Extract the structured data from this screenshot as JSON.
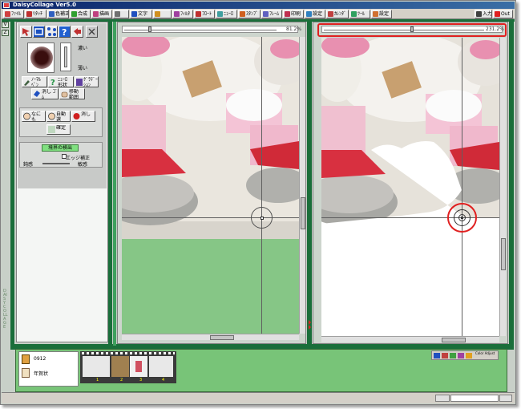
{
  "window": {
    "title": "DaisyCollage Ver5.0"
  },
  "menu": [
    {
      "label": "ﾌｧｲﾙ",
      "color": "#d04040"
    },
    {
      "label": "ﾘﾀｯﾁ",
      "color": "#c03030"
    },
    {
      "label": "色補正",
      "color": "#3060c0"
    },
    {
      "label": "合成",
      "color": "#30a030"
    },
    {
      "label": "描画",
      "color": "#c04080"
    },
    {
      "label": "",
      "color": "#707070"
    },
    {
      "label": "文字",
      "color": "#2050c0"
    },
    {
      "label": "",
      "color": "#d09020"
    },
    {
      "label": "ﾌｨﾙﾀ",
      "color": "#a040a0"
    },
    {
      "label": "ﾌﾛｰﾄ",
      "color": "#c03030"
    },
    {
      "label": "ﾆｭｰﾛ",
      "color": "#40a0a0"
    },
    {
      "label": "ｽﾀﾝﾌﾟ",
      "color": "#d06020"
    },
    {
      "label": "ﾌﾚｰﾑ",
      "color": "#6060c0"
    },
    {
      "label": "印刷",
      "color": "#c03050"
    },
    {
      "label": "設定",
      "color": "#3080c0"
    },
    {
      "label": "ｶﾚﾝﾀﾞ",
      "color": "#c04040"
    },
    {
      "label": "ﾂｰﾙ",
      "color": "#30a060"
    },
    {
      "label": "設定",
      "color": "#d07030"
    }
  ],
  "menu_right": {
    "input_label": "入力",
    "output_label": "Out"
  },
  "left_tabs": [
    "V",
    "Z"
  ],
  "side_vertical_text": "DAISY COLLAGE",
  "tools": {
    "dark_label": "濃い",
    "light_label": "薄い",
    "row1": [
      {
        "label": "ﾉｰﾏﾙ ﾍﾟﾝ",
        "icon": "brush-icon"
      },
      {
        "label": "ﾆｭｰﾛ 形状",
        "icon": "question-icon"
      },
      {
        "label": "ｸﾞﾗﾃﾞｰｼｮﾝ",
        "icon": "gradient-icon"
      }
    ],
    "row2": [
      {
        "label": "消し ｺﾞﾑ",
        "icon": "eraser-icon"
      },
      {
        "label": "移動 範囲",
        "icon": "hand-icon"
      }
    ],
    "row3": [
      {
        "label": "なにも",
        "icon": "face-icon"
      },
      {
        "label": "自動選",
        "icon": "face-icon"
      },
      {
        "label": "消し",
        "icon": "red-dot-icon"
      }
    ],
    "confirm_label": "確定",
    "detect_title": "境界の検出",
    "edge_label": "エッジ補正",
    "dull_label": "鈍感",
    "sensitive_label": "敏感"
  },
  "left_canvas": {
    "zoom": "81.2%"
  },
  "right_canvas": {
    "zoom": "231.2%"
  },
  "colors": {
    "accent_green": "#1a6e3a",
    "mask_green": "#86c686",
    "highlight_red": "#e02020"
  },
  "bottom": {
    "file_name": "0912",
    "file_label": "年賀状",
    "frame_numbers": [
      "1",
      "2",
      "3",
      "4"
    ],
    "tools_label": "Color Adjust"
  }
}
